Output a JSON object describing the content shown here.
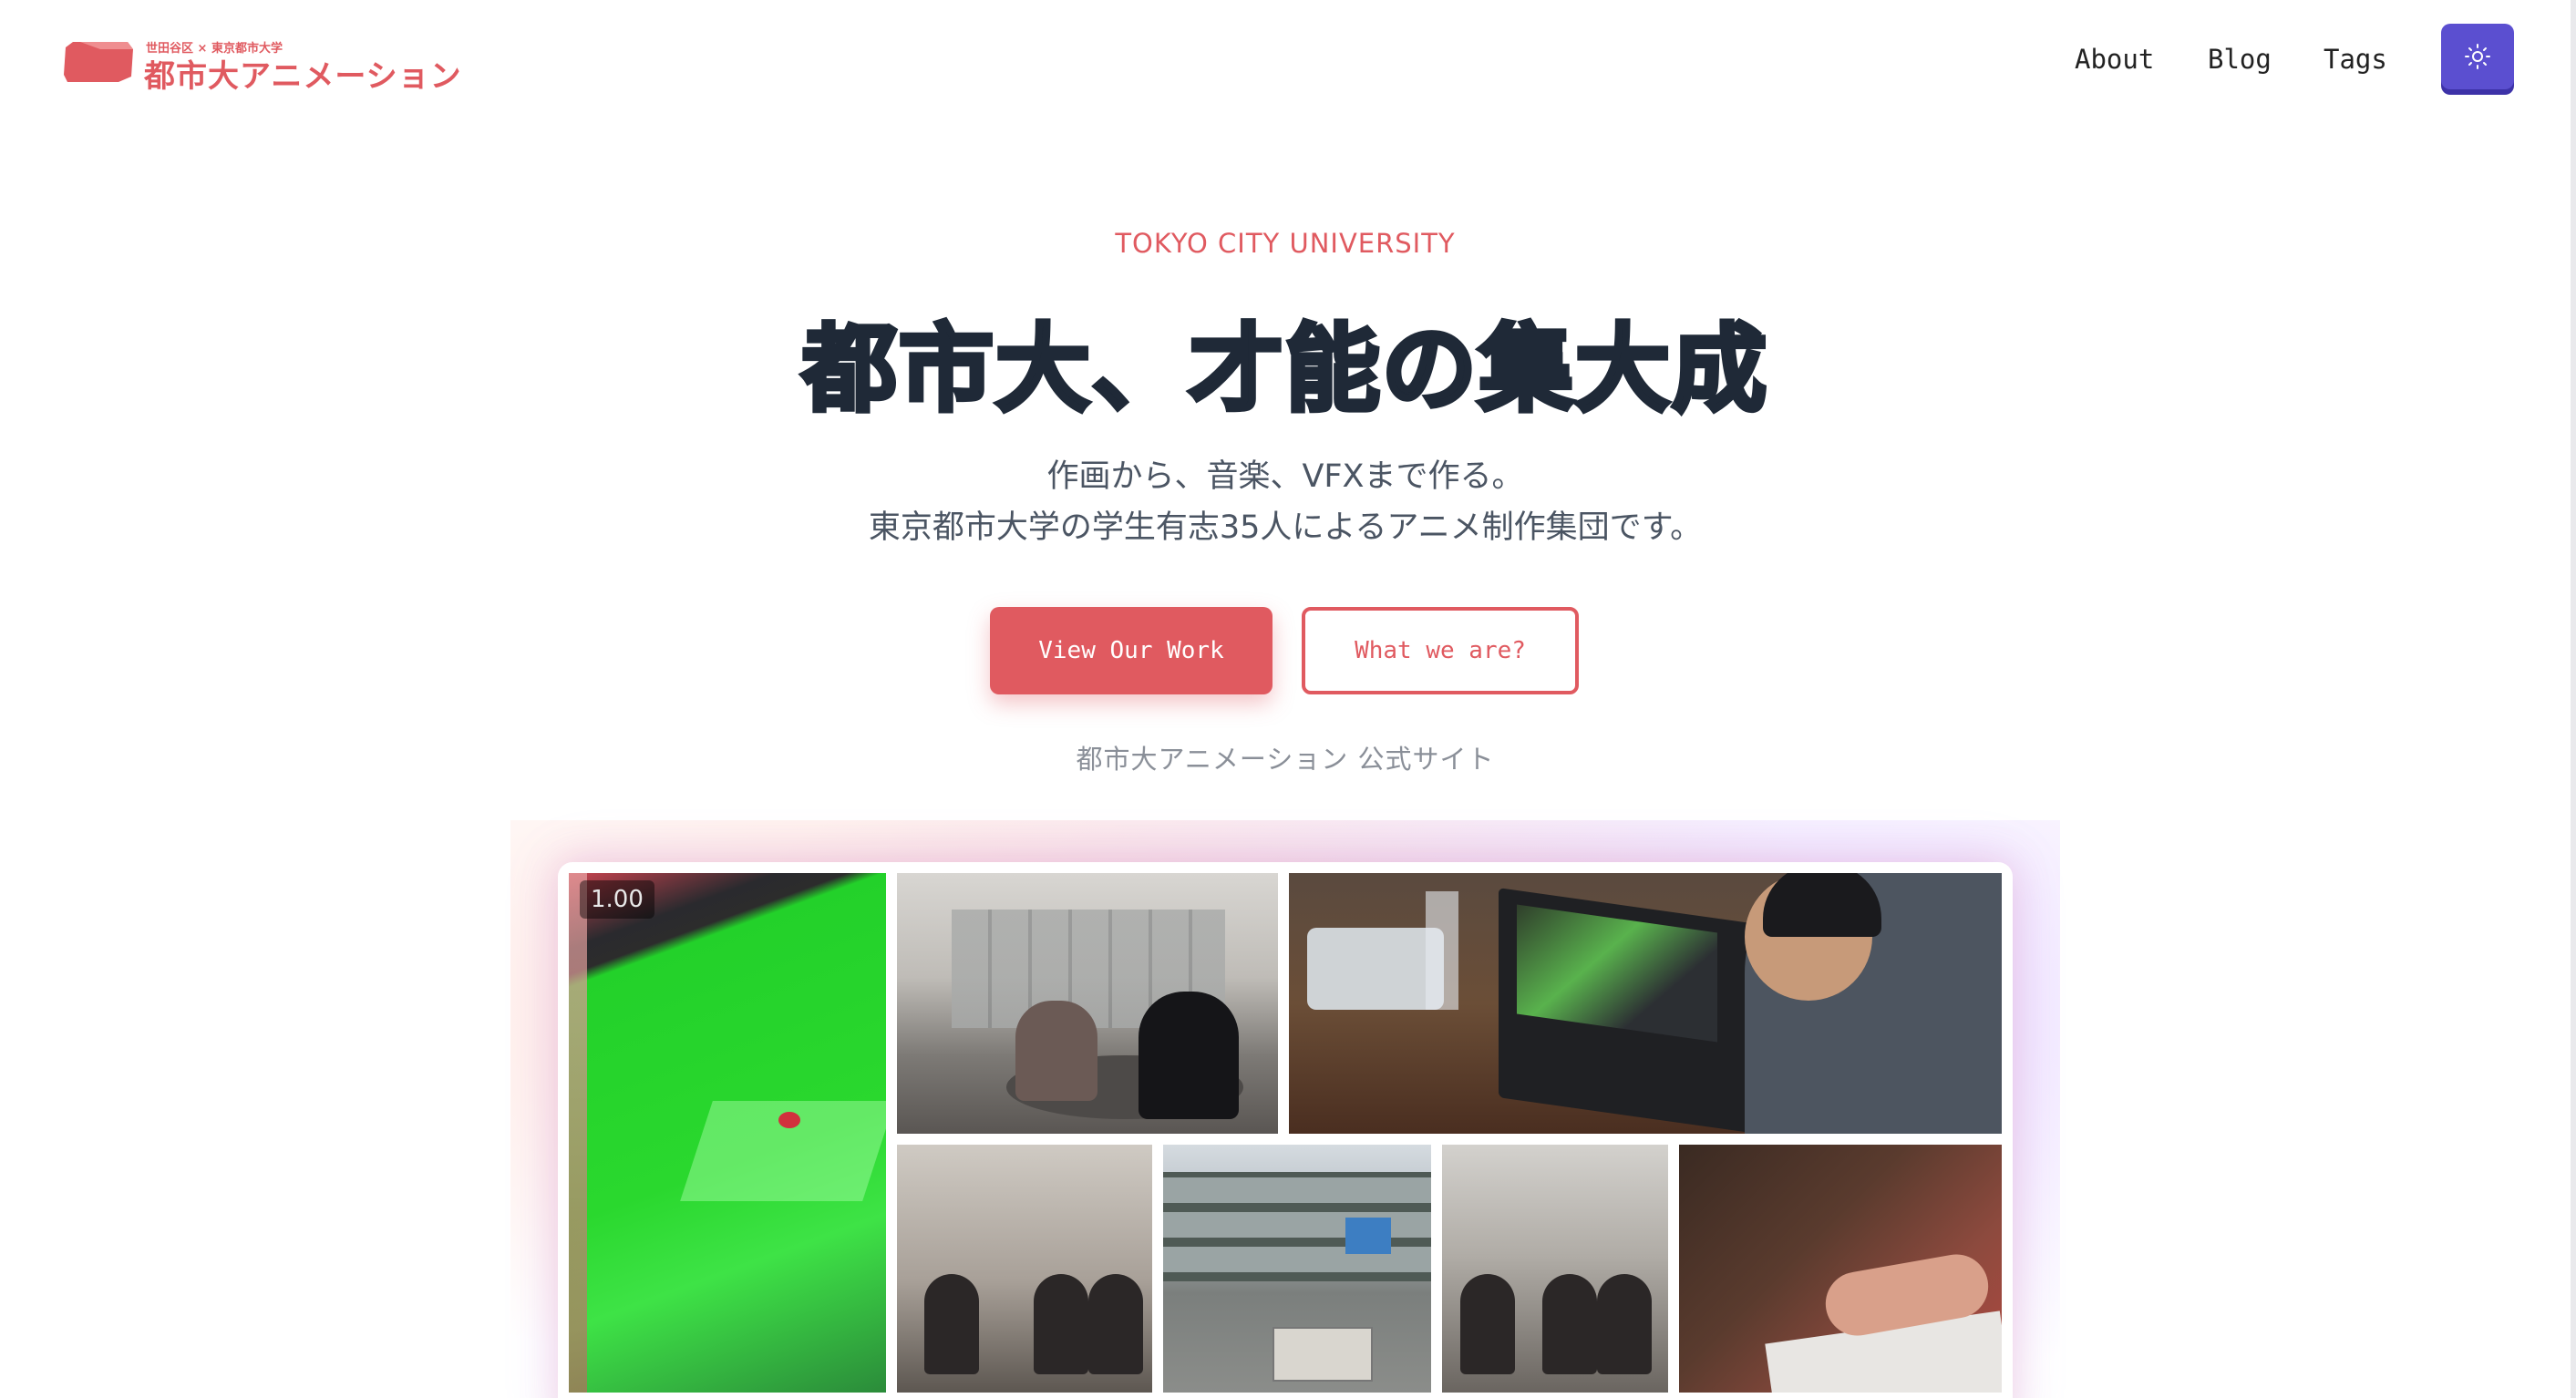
{
  "header": {
    "logo_small": "世田谷区 × 東京都市大学",
    "logo_main": "都市大アニメーション",
    "nav": [
      "About",
      "Blog",
      "Tags"
    ],
    "theme_icon": "sun-icon"
  },
  "hero": {
    "eyebrow": "TOKYO CITY UNIVERSITY",
    "title": "都市大、才能の集大成",
    "subtitle_line1": "作画から、音楽、VFXまで作る。",
    "subtitle_line2": "東京都市大学の学生有志35人によるアニメ制作集団です。",
    "primary_button": "View Our Work",
    "secondary_button": "What we are?",
    "caption": "都市大アニメーション 公式サイト"
  },
  "gallery": {
    "playback_badge": "1.00"
  },
  "colors": {
    "accent": "#e05a60",
    "theme_button": "#5b4fd0",
    "title": "#1f2937"
  }
}
